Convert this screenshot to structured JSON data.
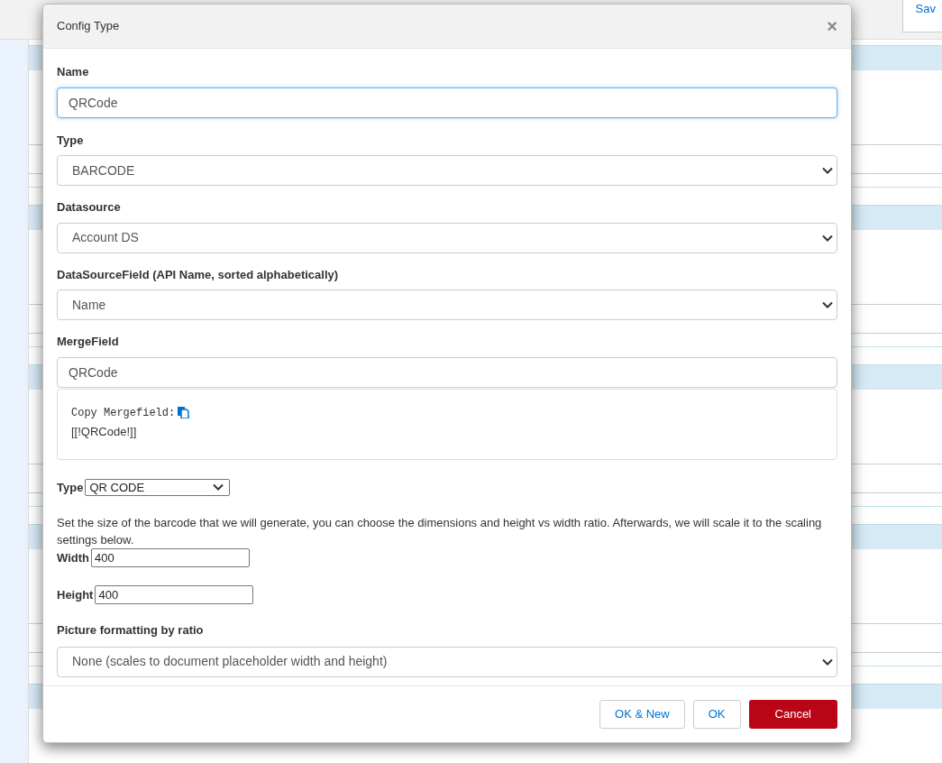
{
  "background": {
    "toolbar_buttons": [
      {
        "label": "Sav",
        "kind": "link"
      }
    ]
  },
  "dialog": {
    "title": "Config Type",
    "close": "×",
    "fields": [
      {
        "kind": "input",
        "label": "Name",
        "value": "QRCode",
        "focused": true
      },
      {
        "kind": "select",
        "label": "Type",
        "value": "BARCODE"
      },
      {
        "kind": "select",
        "label": "Datasource",
        "value": "Account DS"
      },
      {
        "kind": "select",
        "label": "DataSourceField (API Name, sorted alphabetically)",
        "value": "Name"
      },
      {
        "kind": "input",
        "label": "MergeField",
        "value": "QRCode",
        "focused": false
      }
    ],
    "merge_box": {
      "caption": "Copy Mergefield:",
      "value": "[[!QRCode!]]"
    },
    "barcode_type": {
      "label": "Type",
      "value": "QR CODE"
    },
    "size_help": "Set the size of the barcode that we will generate, you can choose the dimensions and height vs width ratio. Afterwards, we will scale it to the scaling settings below.",
    "size_fields": [
      {
        "label": "Width",
        "value": "400"
      },
      {
        "label": "Height",
        "value": "400"
      }
    ],
    "ratio": {
      "label": "Picture formatting by ratio",
      "value": "None (scales to document placeholder width and height)"
    },
    "buttons": [
      {
        "label": "OK & New",
        "kind": "default"
      },
      {
        "label": "OK",
        "kind": "default"
      },
      {
        "label": "Cancel",
        "kind": "danger"
      }
    ]
  }
}
